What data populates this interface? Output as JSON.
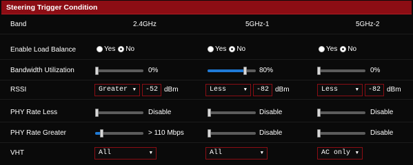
{
  "header": {
    "title": "Steering Trigger Condition"
  },
  "labels": {
    "band": "Band",
    "load_balance": "Enable Load Balance",
    "bandwidth": "Bandwidth Utilization",
    "rssi": "RSSI",
    "phy_less": "PHY Rate Less",
    "phy_greater": "PHY Rate Greater",
    "vht": "VHT"
  },
  "bands": [
    {
      "name": "2.4GHz",
      "load_balance": {
        "yes": "Yes",
        "no": "No",
        "selected": "No"
      },
      "bandwidth": {
        "text": "0%",
        "value": 0
      },
      "rssi": {
        "select": "Greater",
        "value": "-52",
        "unit": "dBm"
      },
      "phy_less": {
        "text": "Disable",
        "value": 0
      },
      "phy_greater": {
        "text": "> 110 Mbps",
        "value": 0.1
      },
      "vht": {
        "select": "All"
      }
    },
    {
      "name": "5GHz-1",
      "load_balance": {
        "yes": "Yes",
        "no": "No",
        "selected": "No"
      },
      "bandwidth": {
        "text": "80%",
        "value": 0.8
      },
      "rssi": {
        "select": "Less",
        "value": "-82",
        "unit": "dBm"
      },
      "phy_less": {
        "text": "Disable",
        "value": 0
      },
      "phy_greater": {
        "text": "Disable",
        "value": 0
      },
      "vht": {
        "select": "All"
      }
    },
    {
      "name": "5GHz-2",
      "load_balance": {
        "yes": "Yes",
        "no": "No",
        "selected": "No"
      },
      "bandwidth": {
        "text": "0%",
        "value": 0
      },
      "rssi": {
        "select": "Less",
        "value": "-82",
        "unit": "dBm"
      },
      "phy_less": {
        "text": "Disable",
        "value": 0
      },
      "phy_greater": {
        "text": "Disable",
        "value": 0
      },
      "vht": {
        "select": "AC only"
      }
    }
  ],
  "colors": {
    "header_bg": "#8c0d14",
    "accent_blue": "#1f7ad6",
    "border_red": "#8c0d14"
  },
  "icons": {
    "dropdown": "chevron-down-icon"
  }
}
